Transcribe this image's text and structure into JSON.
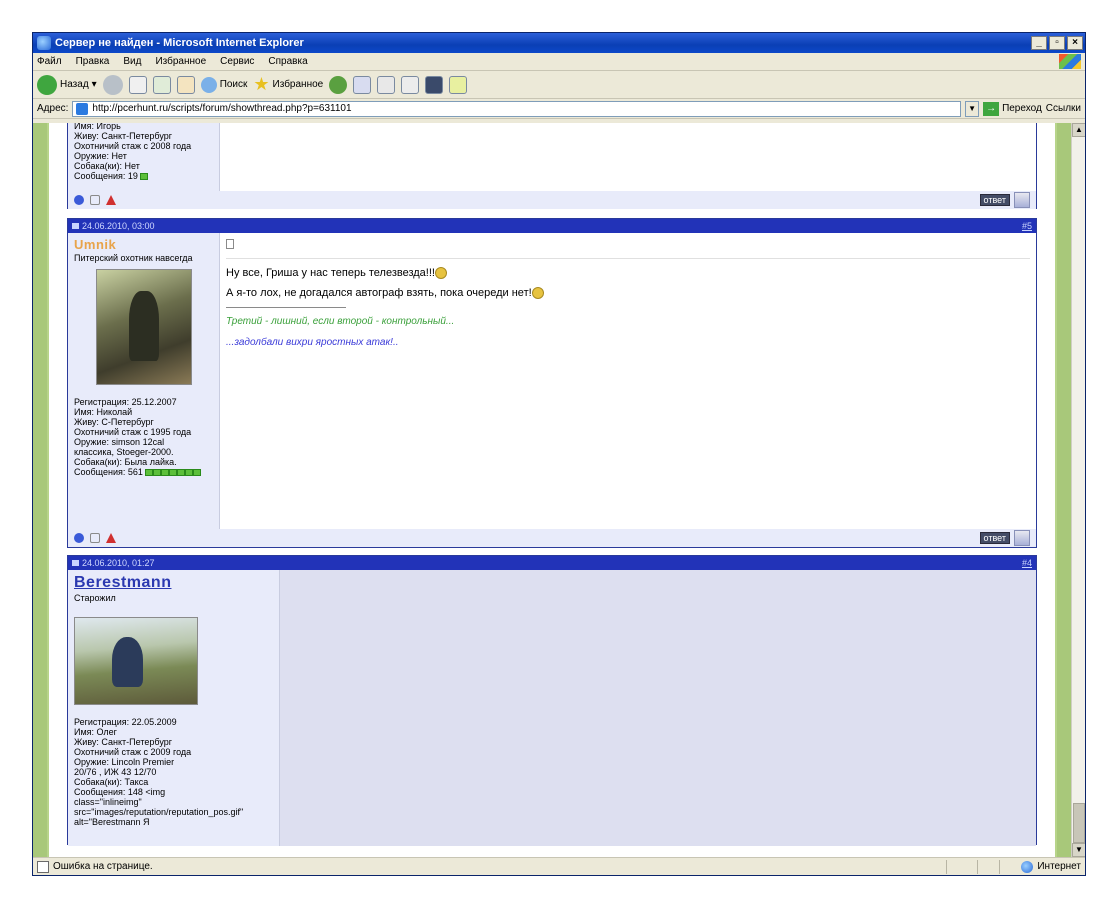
{
  "window": {
    "title": "Сервер не найден - Microsoft Internet Explorer"
  },
  "menu": [
    "Файл",
    "Правка",
    "Вид",
    "Избранное",
    "Сервис",
    "Справка"
  ],
  "toolbar": {
    "back": "Назад",
    "search": "Поиск",
    "favorites": "Избранное"
  },
  "address": {
    "label": "Адрес:",
    "url": "http://pcerhunt.ru/scripts/forum/showthread.php?p=631101",
    "go": "Переход",
    "links": "Ссылки"
  },
  "posts": [
    {
      "info": [
        "Имя: Игорь",
        "Живу: Санкт-Петербург",
        "Охотничий стаж с 2008 года",
        "Оружие: Нет",
        "Собака(ки): Нет"
      ],
      "messages_label": "Сообщения: 19",
      "reply": "ответ"
    },
    {
      "date": "24.06.2010, 03:00",
      "number": "#5",
      "username": "Umnik",
      "usertitle": "Питерский охотник навсегда",
      "info": [
        "Регистрация: 25.12.2007",
        "Имя: Николай",
        "Живу: С-Петербург",
        "Охотничий стаж с 1995 года",
        "Оружие: simson 12cal",
        "классика, Stoeger-2000.",
        "Собака(ки): Была лайка."
      ],
      "messages_label": "Сообщения: 561",
      "text_1": "Ну все, Гриша у нас теперь телезвезда!!!",
      "text_2": "А я-то лох, не догадался автограф взять, пока очереди нет!",
      "sig_1": "Третий - лишний, если второй - контрольный...",
      "sig_2": "...задолбали вихри яростных атак!..",
      "reply": "ответ"
    },
    {
      "date": "24.06.2010, 01:27",
      "number": "#4",
      "username": "Berestmann",
      "usertitle": "Старожил",
      "info": [
        "Регистрация: 22.05.2009",
        "Имя: Олег",
        "Живу: Санкт-Петербург",
        "Охотничий стаж с 2009 года",
        "Оружие: Lincoln Premier",
        "20/76 , ИЖ 43 12/70",
        "Собака(ки): Такса",
        "Сообщения: 148 <img",
        "class=\"inlineimg\"",
        "src=\"images/reputation/reputation_pos.gif\"",
        "alt=\"Berestmann Я"
      ]
    }
  ],
  "status": {
    "text": "Ошибка на странице.",
    "zone": "Интернет"
  }
}
